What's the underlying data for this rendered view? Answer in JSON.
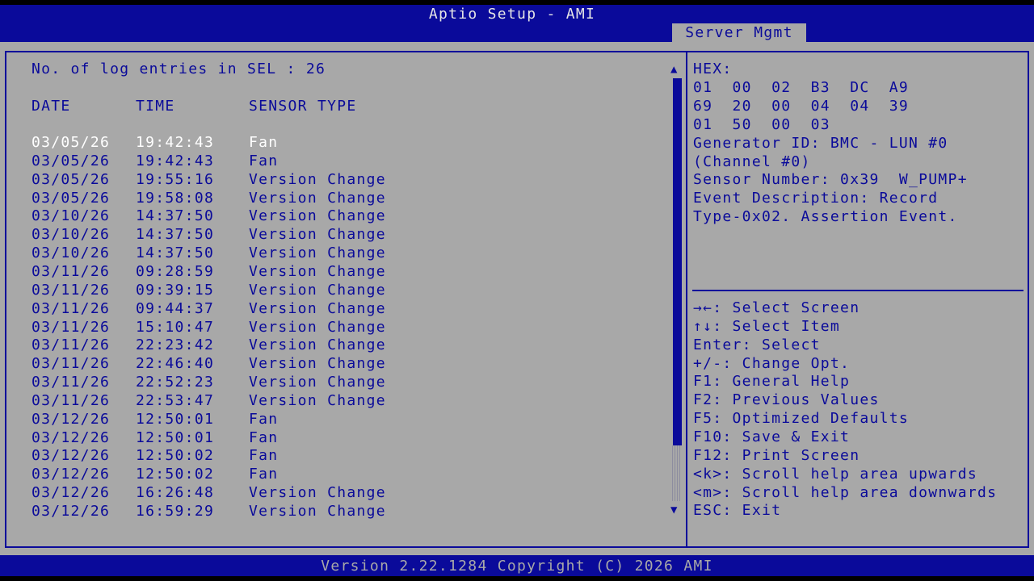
{
  "app_title": "Aptio Setup - AMI",
  "active_tab": "Server Mgmt",
  "left": {
    "count_label": "No. of log entries in SEL : 26",
    "headers": {
      "date": "DATE",
      "time": "TIME",
      "sensor": "SENSOR TYPE"
    },
    "rows": [
      {
        "date": "03/05/26",
        "time": "19:42:43",
        "sensor": "Fan"
      },
      {
        "date": "03/05/26",
        "time": "19:42:43",
        "sensor": "Fan"
      },
      {
        "date": "03/05/26",
        "time": "19:55:16",
        "sensor": "Version Change"
      },
      {
        "date": "03/05/26",
        "time": "19:58:08",
        "sensor": "Version Change"
      },
      {
        "date": "03/10/26",
        "time": "14:37:50",
        "sensor": "Version Change"
      },
      {
        "date": "03/10/26",
        "time": "14:37:50",
        "sensor": "Version Change"
      },
      {
        "date": "03/10/26",
        "time": "14:37:50",
        "sensor": "Version Change"
      },
      {
        "date": "03/11/26",
        "time": "09:28:59",
        "sensor": "Version Change"
      },
      {
        "date": "03/11/26",
        "time": "09:39:15",
        "sensor": "Version Change"
      },
      {
        "date": "03/11/26",
        "time": "09:44:37",
        "sensor": "Version Change"
      },
      {
        "date": "03/11/26",
        "time": "15:10:47",
        "sensor": "Version Change"
      },
      {
        "date": "03/11/26",
        "time": "22:23:42",
        "sensor": "Version Change"
      },
      {
        "date": "03/11/26",
        "time": "22:46:40",
        "sensor": "Version Change"
      },
      {
        "date": "03/11/26",
        "time": "22:52:23",
        "sensor": "Version Change"
      },
      {
        "date": "03/11/26",
        "time": "22:53:47",
        "sensor": "Version Change"
      },
      {
        "date": "03/12/26",
        "time": "12:50:01",
        "sensor": "Fan"
      },
      {
        "date": "03/12/26",
        "time": "12:50:01",
        "sensor": "Fan"
      },
      {
        "date": "03/12/26",
        "time": "12:50:02",
        "sensor": "Fan"
      },
      {
        "date": "03/12/26",
        "time": "12:50:02",
        "sensor": "Fan"
      },
      {
        "date": "03/12/26",
        "time": "16:26:48",
        "sensor": "Version Change"
      },
      {
        "date": "03/12/26",
        "time": "16:59:29",
        "sensor": "Version Change"
      }
    ]
  },
  "scrollbar": {
    "up_glyph": "▲",
    "down_glyph": "▼"
  },
  "help_lines": [
    "HEX:",
    "01  00  02  B3  DC  A9",
    "69  20  00  04  04  39",
    "01  50  00  03",
    "Generator ID: BMC - LUN #0",
    "(Channel #0)",
    "Sensor Number: 0x39  W_PUMP+",
    "Event Description: Record",
    "Type-0x02. Assertion Event."
  ],
  "keys": [
    "→←: Select Screen",
    "↑↓: Select Item",
    "Enter: Select",
    "+/-: Change Opt.",
    "F1: General Help",
    "F2: Previous Values",
    "F5: Optimized Defaults",
    "F10: Save & Exit",
    "F12: Print Screen",
    "<k>: Scroll help area upwards",
    "<m>: Scroll help area downwards",
    "ESC: Exit"
  ],
  "footer": "Version 2.22.1284 Copyright (C) 2026 AMI",
  "colors": {
    "blue": "#0a0a9a",
    "gray": "#a8a8a8",
    "highlight": "#ffffff"
  }
}
